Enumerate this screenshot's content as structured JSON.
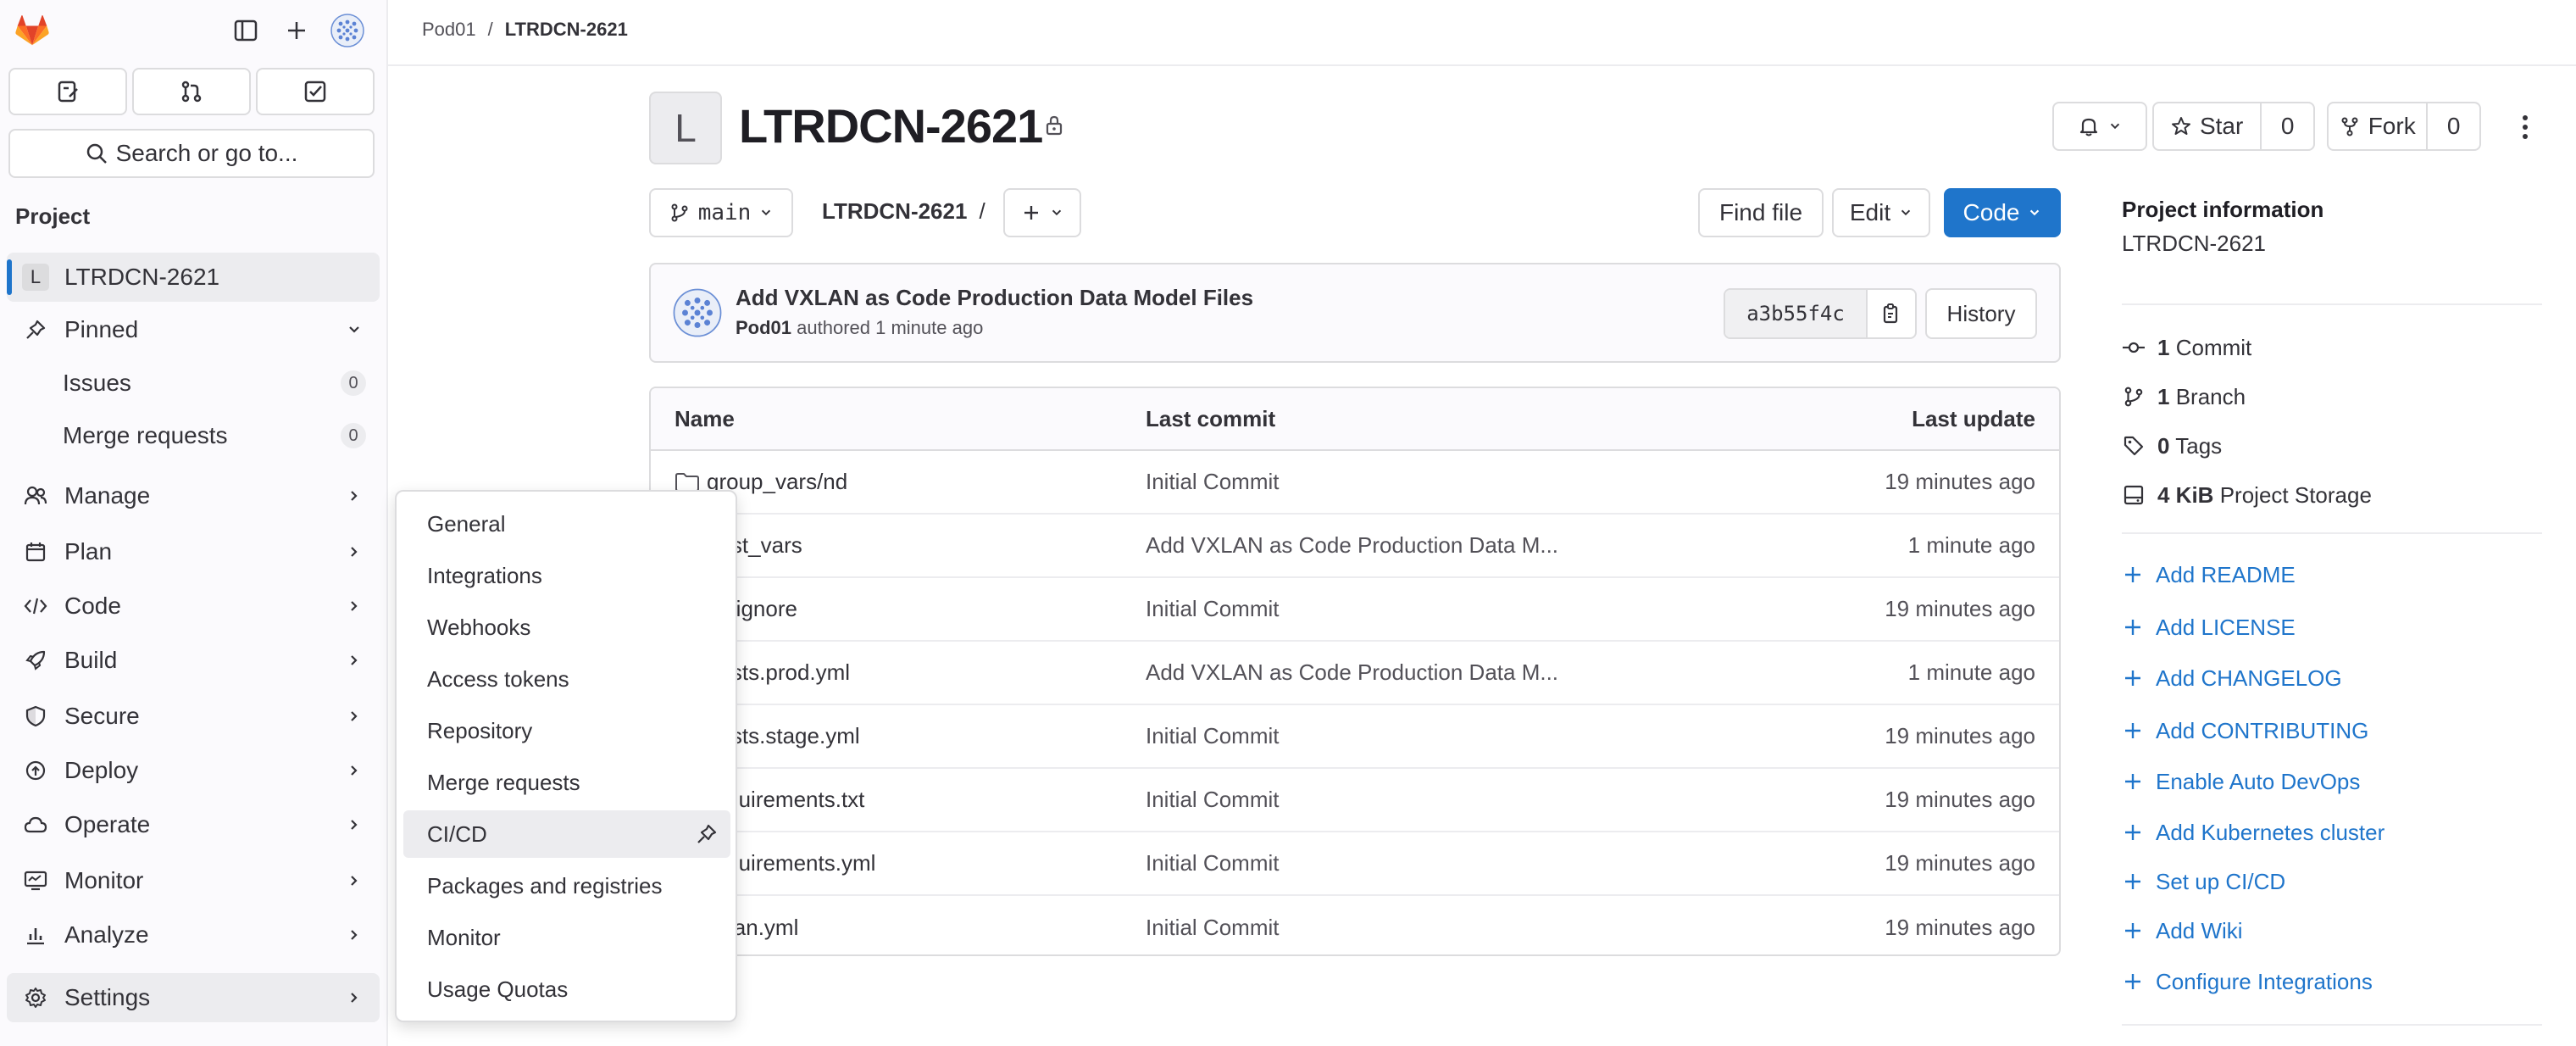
{
  "sidebar": {
    "search_label": "Search or go to...",
    "section_label": "Project",
    "project_item": {
      "avatar_letter": "L",
      "label": "LTRDCN-2621"
    },
    "pinned_label": "Pinned",
    "pinned_items": [
      {
        "label": "Issues",
        "count": "0"
      },
      {
        "label": "Merge requests",
        "count": "0"
      }
    ],
    "nav_items": [
      {
        "label": "Manage",
        "icon": "users-icon"
      },
      {
        "label": "Plan",
        "icon": "plan-icon"
      },
      {
        "label": "Code",
        "icon": "code-icon"
      },
      {
        "label": "Build",
        "icon": "rocket-icon"
      },
      {
        "label": "Secure",
        "icon": "shield-icon"
      },
      {
        "label": "Deploy",
        "icon": "deploy-icon"
      },
      {
        "label": "Operate",
        "icon": "cloud-icon"
      },
      {
        "label": "Monitor",
        "icon": "monitor-icon"
      },
      {
        "label": "Analyze",
        "icon": "chart-icon"
      },
      {
        "label": "Settings",
        "icon": "gear-icon"
      }
    ]
  },
  "breadcrumb": {
    "group": "Pod01",
    "separator": "/",
    "project": "LTRDCN-2621"
  },
  "header": {
    "avatar_letter": "L",
    "title": "LTRDCN-2621",
    "star_label": "Star",
    "star_count": "0",
    "fork_label": "Fork",
    "fork_count": "0"
  },
  "toolbar": {
    "branch": "main",
    "path": "LTRDCN-2621",
    "path_sep": "/",
    "find_file": "Find file",
    "edit": "Edit",
    "code": "Code"
  },
  "last_commit": {
    "title": "Add VXLAN as Code Production Data Model Files",
    "author": "Pod01",
    "authored_text": "authored 1 minute ago",
    "sha": "a3b55f4c",
    "history_label": "History"
  },
  "file_table": {
    "headers": {
      "name": "Name",
      "last_commit": "Last commit",
      "last_update": "Last update"
    },
    "rows": [
      {
        "name": "group_vars/nd",
        "commit": "Initial Commit",
        "updated": "19 minutes ago",
        "folder": true
      },
      {
        "name": "host_vars",
        "commit": "Add VXLAN as Code Production Data M...",
        "updated": "1 minute ago",
        "folder": true
      },
      {
        "name": ".gitignore",
        "commit": "Initial Commit",
        "updated": "19 minutes ago",
        "folder": false
      },
      {
        "name": "hosts.prod.yml",
        "commit": "Add VXLAN as Code Production Data M...",
        "updated": "1 minute ago",
        "folder": false
      },
      {
        "name": "hosts.stage.yml",
        "commit": "Initial Commit",
        "updated": "19 minutes ago",
        "folder": false
      },
      {
        "name": "requirements.txt",
        "commit": "Initial Commit",
        "updated": "19 minutes ago",
        "folder": false
      },
      {
        "name": "requirements.yml",
        "commit": "Initial Commit",
        "updated": "19 minutes ago",
        "folder": false
      },
      {
        "name": "vxlan.yml",
        "commit": "Initial Commit",
        "updated": "19 minutes ago",
        "folder": false
      }
    ]
  },
  "project_info": {
    "title": "Project information",
    "name": "LTRDCN-2621",
    "stats": [
      {
        "value": "1",
        "label": "Commit",
        "icon": "commit-icon"
      },
      {
        "value": "1",
        "label": "Branch",
        "icon": "branch-icon"
      },
      {
        "value": "0",
        "label": "Tags",
        "icon": "tag-icon"
      },
      {
        "value": "4 KiB",
        "label": "Project Storage",
        "icon": "storage-icon"
      }
    ],
    "links": [
      "Add README",
      "Add LICENSE",
      "Add CHANGELOG",
      "Add CONTRIBUTING",
      "Enable Auto DevOps",
      "Add Kubernetes cluster",
      "Set up CI/CD",
      "Add Wiki",
      "Configure Integrations"
    ]
  },
  "settings_flyout": {
    "items": [
      "General",
      "Integrations",
      "Webhooks",
      "Access tokens",
      "Repository",
      "Merge requests",
      "CI/CD",
      "Packages and registries",
      "Monitor",
      "Usage Quotas"
    ],
    "active_item": "CI/CD"
  },
  "colors": {
    "accent": "#1f75cb",
    "sidebar_bg": "#fbfafd",
    "active_bg": "#ececef",
    "border": "#dcdcde",
    "logo_orange": "#fc6d26"
  }
}
